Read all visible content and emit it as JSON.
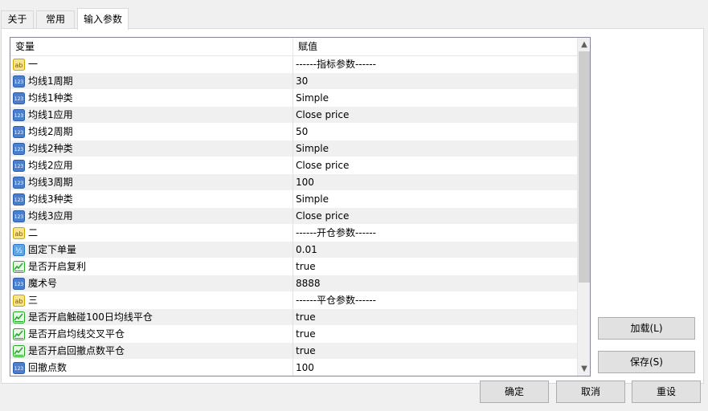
{
  "tabs": [
    {
      "label": "关于"
    },
    {
      "label": "常用"
    },
    {
      "label": "输入参数"
    }
  ],
  "grid": {
    "col_variable": "变量",
    "col_value": "赋值",
    "rows": [
      {
        "name": "一",
        "value": "------指标参数------",
        "icon": "ab-icon",
        "shade": false
      },
      {
        "name": "均线1周期",
        "value": "30",
        "icon": "int-icon",
        "shade": true
      },
      {
        "name": "均线1种类",
        "value": "Simple",
        "icon": "int-icon",
        "shade": false
      },
      {
        "name": "均线1应用",
        "value": "Close price",
        "icon": "int-icon",
        "shade": true
      },
      {
        "name": "均线2周期",
        "value": "50",
        "icon": "int-icon",
        "shade": false
      },
      {
        "name": "均线2种类",
        "value": "Simple",
        "icon": "int-icon",
        "shade": true
      },
      {
        "name": "均线2应用",
        "value": "Close price",
        "icon": "int-icon",
        "shade": false
      },
      {
        "name": "均线3周期",
        "value": "100",
        "icon": "int-icon",
        "shade": true
      },
      {
        "name": "均线3种类",
        "value": "Simple",
        "icon": "int-icon",
        "shade": false
      },
      {
        "name": "均线3应用",
        "value": "Close price",
        "icon": "int-icon",
        "shade": true
      },
      {
        "name": "二",
        "value": "------开仓参数------",
        "icon": "ab-icon",
        "shade": false
      },
      {
        "name": "固定下单量",
        "value": "0.01",
        "icon": "fraction-icon",
        "shade": true
      },
      {
        "name": "是否开启复利",
        "value": "true",
        "icon": "bool-icon",
        "shade": false
      },
      {
        "name": "魔术号",
        "value": "8888",
        "icon": "int-icon",
        "shade": true
      },
      {
        "name": "三",
        "value": "------平仓参数------",
        "icon": "ab-icon",
        "shade": false
      },
      {
        "name": "是否开启触碰100日均线平仓",
        "value": "true",
        "icon": "bool-icon",
        "shade": true
      },
      {
        "name": "是否开启均线交叉平仓",
        "value": "true",
        "icon": "bool-icon",
        "shade": false
      },
      {
        "name": "是否开启回撤点数平仓",
        "value": "true",
        "icon": "bool-icon",
        "shade": true
      },
      {
        "name": "回撤点数",
        "value": "100",
        "icon": "int-icon",
        "shade": false
      }
    ]
  },
  "icons": {
    "ab": {
      "text": "ab",
      "bg": "#f6e58d",
      "fg": "#7a5b00"
    },
    "int": {
      "text": "123",
      "bg": "#4a7fd0",
      "fg": "#ffffff"
    },
    "fraction": {
      "text": "½",
      "bg": "#5aa6e8",
      "fg": "#ffffff"
    },
    "bool_color": "#2aa82a"
  },
  "buttons": {
    "load": "加载(L)",
    "save": "保存(S)",
    "ok": "确定",
    "cancel": "取消",
    "reset": "重设"
  }
}
